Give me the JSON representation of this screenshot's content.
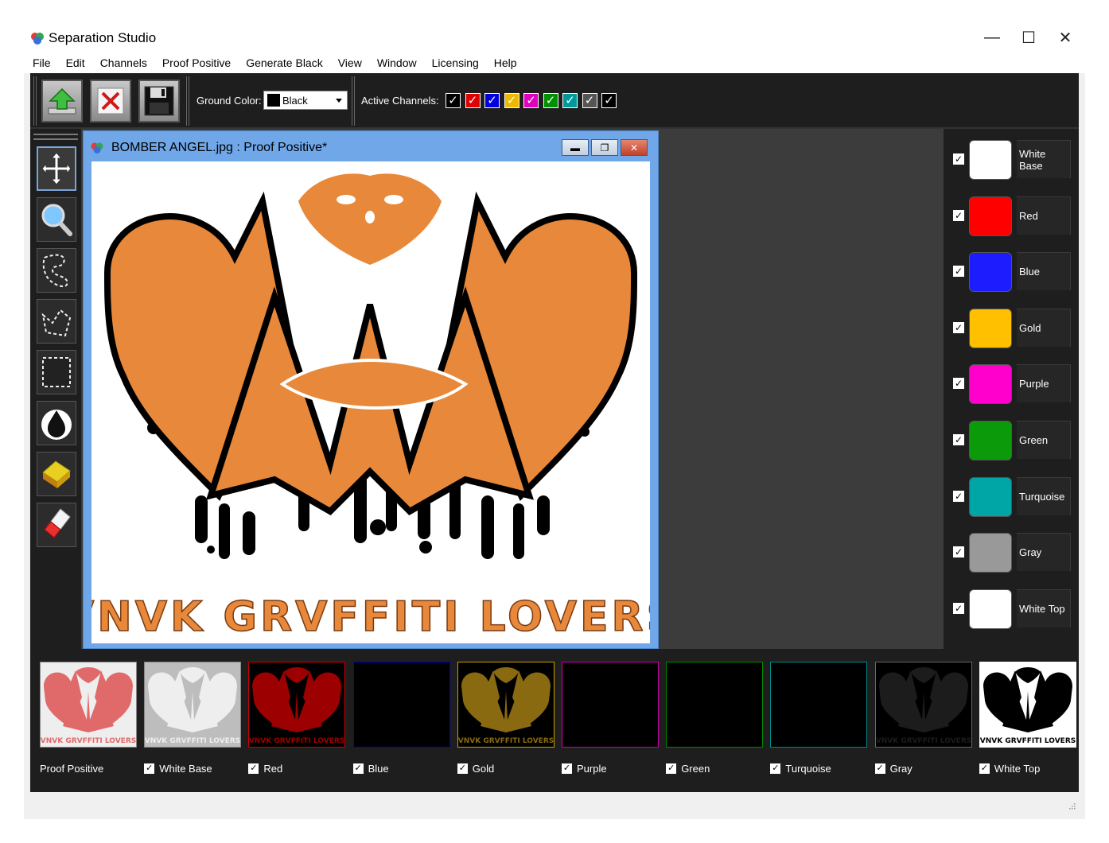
{
  "app": {
    "title": "Separation Studio",
    "window_controls": {
      "minimize": "—",
      "maximize": "☐",
      "close": "✕"
    }
  },
  "menu": [
    "File",
    "Edit",
    "Channels",
    "Proof Positive",
    "Generate Black",
    "View",
    "Window",
    "Licensing",
    "Help"
  ],
  "toolbar": {
    "ground_color_label": "Ground Color:",
    "ground_color_value": "Black",
    "active_channels_label": "Active Channels:",
    "active_channels": [
      {
        "name": "White Base",
        "color": "#000000",
        "checked": true
      },
      {
        "name": "Red",
        "color": "#e00000",
        "checked": true
      },
      {
        "name": "Blue",
        "color": "#0000e0",
        "checked": true
      },
      {
        "name": "Gold",
        "color": "#f0b800",
        "checked": true
      },
      {
        "name": "Purple",
        "color": "#e000c0",
        "checked": true
      },
      {
        "name": "Green",
        "color": "#009000",
        "checked": true
      },
      {
        "name": "Turquoise",
        "color": "#009a9a",
        "checked": true
      },
      {
        "name": "Gray",
        "color": "#555555",
        "checked": true
      },
      {
        "name": "White Top",
        "color": "#000000",
        "checked": true
      }
    ]
  },
  "tools": [
    "move-icon",
    "zoom-icon",
    "lasso-icon",
    "polygon-lasso-icon",
    "rect-select-icon",
    "ink-drop-icon",
    "sponge-icon",
    "eraser-icon"
  ],
  "document": {
    "title": "BOMBER ANGEL.jpg : Proof Positive*",
    "artwork_text": "VNVK GRVFFITI LOVERS",
    "controls": {
      "minimize": "▬",
      "restore": "❐",
      "close": "✕"
    }
  },
  "channels": [
    {
      "label": "White Base",
      "color": "#ffffff",
      "checked": true
    },
    {
      "label": "Red",
      "color": "#ff0000",
      "checked": true
    },
    {
      "label": "Blue",
      "color": "#1c1cff",
      "checked": true
    },
    {
      "label": "Gold",
      "color": "#ffc000",
      "checked": true
    },
    {
      "label": "Purple",
      "color": "#ff00cc",
      "checked": true
    },
    {
      "label": "Green",
      "color": "#0a9a0a",
      "checked": true
    },
    {
      "label": "Turquoise",
      "color": "#00a6a6",
      "checked": true
    },
    {
      "label": "Gray",
      "color": "#999999",
      "checked": true
    },
    {
      "label": "White Top",
      "color": "#ffffff",
      "checked": true
    }
  ],
  "strip": [
    {
      "label": "Proof Positive",
      "has_check": false,
      "border": "#888888",
      "fill": "#eeeeee",
      "art": "#e06a6a"
    },
    {
      "label": "White Base",
      "has_check": true,
      "border": "#888888",
      "fill": "#bdbdbd",
      "art": "#eeeeee"
    },
    {
      "label": "Red",
      "has_check": true,
      "border": "#cc0000",
      "fill": "#000000",
      "art": "#9c0000"
    },
    {
      "label": "Blue",
      "has_check": true,
      "border": "#0000cc",
      "fill": "#000000",
      "art": ""
    },
    {
      "label": "Gold",
      "has_check": true,
      "border": "#c8a000",
      "fill": "#000000",
      "art": "#8a6a10"
    },
    {
      "label": "Purple",
      "has_check": true,
      "border": "#cc00aa",
      "fill": "#000000",
      "art": ""
    },
    {
      "label": "Green",
      "has_check": true,
      "border": "#008800",
      "fill": "#000000",
      "art": ""
    },
    {
      "label": "Turquoise",
      "has_check": true,
      "border": "#008a8a",
      "fill": "#000000",
      "art": ""
    },
    {
      "label": "Gray",
      "has_check": true,
      "border": "#666666",
      "fill": "#000000",
      "art": "#1c1c1c"
    },
    {
      "label": "White Top",
      "has_check": true,
      "border": "#ffffff",
      "fill": "#ffffff",
      "art": "#000000"
    }
  ],
  "strip_art_text": "VNVK GRVFFITI LOVERS"
}
